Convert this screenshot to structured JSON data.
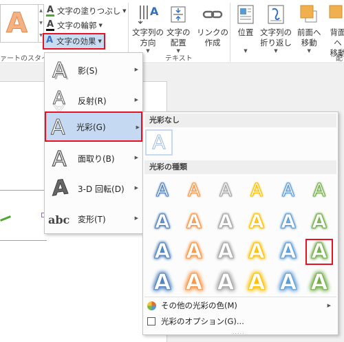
{
  "ribbon": {
    "style_group_label": "ァートのスタイル",
    "text_group_label": "テキスト",
    "arrange_group_label_partial": "配",
    "quick_style_preview": "A",
    "fill_label": "文字の塗りつぶし",
    "outline_label": "文字の輪郭",
    "effects_label": "文字の効果",
    "text_direction": {
      "line1": "文字列の",
      "line2": "方向"
    },
    "text_align": {
      "line1": "文字の",
      "line2": "配置"
    },
    "create_link": {
      "line1": "リンクの",
      "line2": "作成"
    },
    "position": {
      "line1": "位置"
    },
    "wrap_text": {
      "line1": "文字列の",
      "line2": "折り返し"
    },
    "bring_forward": {
      "line1": "前面へ",
      "line2": "移動"
    },
    "send_backward": {
      "line1": "背面へ",
      "line2": "移動"
    }
  },
  "effects_menu": {
    "items": [
      {
        "label": "影(S)",
        "icon": "shadow-a-icon"
      },
      {
        "label": "反射(R)",
        "icon": "reflection-a-icon"
      },
      {
        "label": "光彩(G)",
        "icon": "glow-a-icon",
        "selected": true
      },
      {
        "label": "面取り(B)",
        "icon": "bevel-a-icon"
      },
      {
        "label": "3-D 回転(D)",
        "icon": "rotation-3d-a-icon"
      },
      {
        "label": "変形(T)",
        "icon": "transform-abc-icon"
      }
    ]
  },
  "glow_menu": {
    "no_glow_heading": "光彩なし",
    "variations_heading": "光彩の種類",
    "cell_letter": "A",
    "glow_colors": [
      "#4f81bd",
      "#f79646",
      "#a5a5a5",
      "#ffc000",
      "#5b9bd5",
      "#70ad47"
    ],
    "rows": 4,
    "highlighted": {
      "row": 3,
      "col": 6
    },
    "more_colors_label": "その他の光彩の色(M)",
    "options_label": "光彩のオプション(G)...",
    "grip": "....."
  },
  "colors": {
    "highlight_red": "#e81123",
    "selection_blue": "#c5daf2"
  }
}
